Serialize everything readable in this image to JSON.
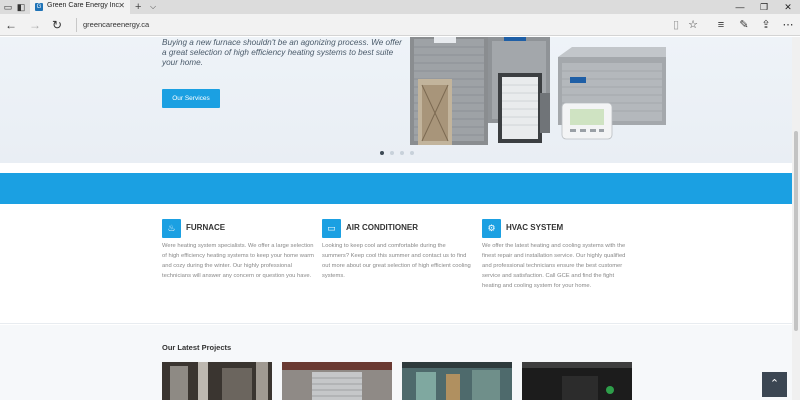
{
  "browser": {
    "tab_title": "Green Care Energy Inc.",
    "favicon_letter": "G",
    "url": "greencareenergy.ca",
    "icons": {
      "tab_manager": "tab-manager-icon",
      "tab_back": "tab-history-icon",
      "new_tab": "plus-icon",
      "tab_list": "chevron-down-icon",
      "back": "arrow-left-icon",
      "forward": "arrow-right-icon",
      "refresh": "refresh-icon",
      "reading_view": "book-icon",
      "favorite": "star-icon",
      "hub": "hub-icon",
      "notes": "pen-icon",
      "share": "share-icon",
      "more": "more-icon"
    }
  },
  "hero": {
    "tagline": "Buying a new furnace shouldn't be an agonizing process. We offer a great selection of high efficiency heating systems to best suite your home.",
    "button_label": "Our Services",
    "slide_count": 4,
    "active_slide": 1
  },
  "services": [
    {
      "title": "FURNACE",
      "icon": "flame-icon",
      "text": "Were heating system specialists. We offer a large selection of high efficiency heating systems to keep your home warm and cozy during the winter. Our highly professional technicians will answer any concern or question you have."
    },
    {
      "title": "AIR CONDITIONER",
      "icon": "monitor-icon",
      "text": "Looking to keep cool and comfortable during the summers? Keep cool this summer and contact us to find out more about our great selection of high efficient cooling systems."
    },
    {
      "title": "HVAC SYSTEM",
      "icon": "gear-icon",
      "text": "We offer the latest heating and cooling systems with the finest repair and installation service. Our highly qualified and professional technicians ensure the best customer service and satisfaction. Call GCE and find the fight heating and cooling system for your home."
    }
  ],
  "projects": {
    "title": "Our Latest Projects"
  },
  "colors": {
    "accent": "#1ba0e2",
    "dark": "#3b4652",
    "hero_bg": "#eef3f8"
  }
}
